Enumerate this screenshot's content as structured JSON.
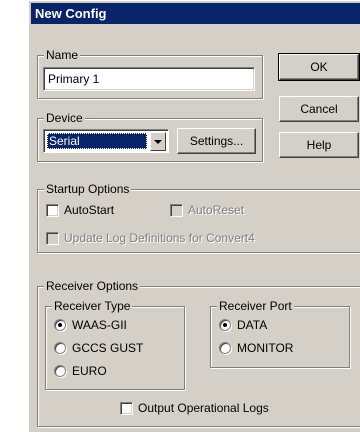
{
  "dialog": {
    "title": "New Config"
  },
  "name_group": {
    "legend": "Name",
    "value": "Primary 1"
  },
  "device_group": {
    "legend": "Device",
    "selected": "Serial",
    "settings_label": "Settings..."
  },
  "buttons": {
    "ok": "OK",
    "cancel": "Cancel",
    "help": "Help"
  },
  "startup": {
    "legend": "Startup Options",
    "autostart": {
      "label": "AutoStart",
      "checked": false
    },
    "autoreset": {
      "label": "AutoReset",
      "checked": false,
      "enabled": false
    },
    "update_log": {
      "label": "Update Log Definitions for Convert4",
      "checked": false,
      "enabled": false
    }
  },
  "receiver_options": {
    "legend": "Receiver Options",
    "type_group": {
      "legend": "Receiver Type",
      "options": [
        "WAAS-GII",
        "GCCS GUST",
        "EURO"
      ],
      "selected": "WAAS-GII"
    },
    "port_group": {
      "legend": "Receiver Port",
      "options": [
        "DATA",
        "MONITOR"
      ],
      "selected": "DATA"
    },
    "output_logs": {
      "label": "Output Operational Logs",
      "checked": false
    }
  },
  "colors": {
    "titlebar": "#0a246a",
    "face": "#d4d0c8",
    "selection": "#0a246a"
  }
}
